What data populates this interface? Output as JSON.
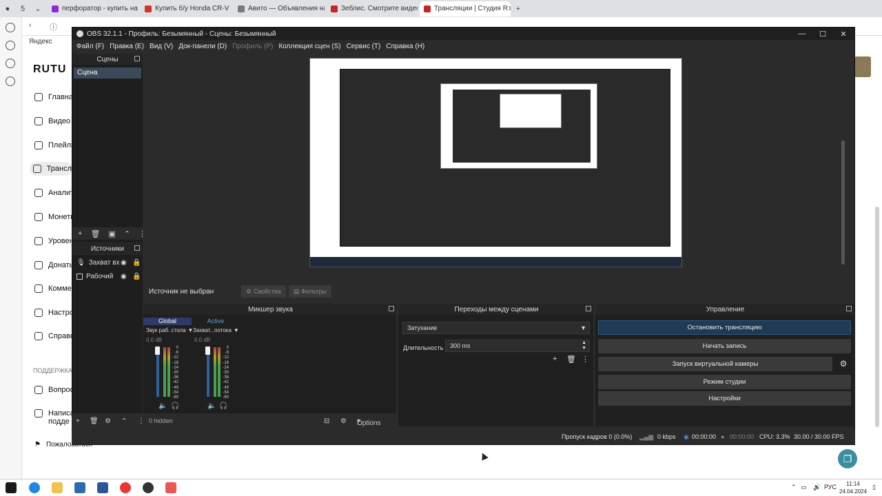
{
  "browser": {
    "tabs": [
      {
        "label": "перфоратор - купить на (",
        "color": "#8a2be2"
      },
      {
        "label": "Купить б/у Honda CR-V II",
        "color": "#d93025"
      },
      {
        "label": "Авито — Объявления на",
        "color": "#7a7a7a"
      },
      {
        "label": "Зеблис. Смотрите видео",
        "color": "#cc2222"
      },
      {
        "label": "Трансляции | Студия R",
        "color": "#cc2222"
      }
    ],
    "tab_count": "5",
    "bookmark": "Яндекс"
  },
  "page": {
    "logo": "RUTU",
    "nav": [
      "Главная",
      "Видео",
      "Плейли",
      "Трансл",
      "Аналит",
      "Монети",
      "Уровен",
      "Донаты",
      "Коммен",
      "Настро",
      "Справо"
    ],
    "support_heading": "ПОДДЕРЖКА",
    "support": [
      "Вопросы",
      "Написа",
      "подде"
    ],
    "complain": "Пожаловаться"
  },
  "obs": {
    "title": "OBS 32.1.1 - Профиль: Безымянный - Сцены: Безымянный",
    "menu": [
      "Файл (F)",
      "Правка (E)",
      "Вид (V)",
      "Док-панели (D)",
      "Профиль (P)",
      "Коллекция сцен (S)",
      "Сервис (T)",
      "Справка (H)"
    ],
    "scenes": {
      "heading": "Сцены",
      "items": [
        "Сцена"
      ]
    },
    "sources": {
      "heading": "Источники",
      "items": [
        "Захват вх",
        "Рабочий"
      ]
    },
    "context": {
      "no_source": "Источник не выбран",
      "properties": "Свойства",
      "filters": "Фильтры"
    },
    "mixer": {
      "heading": "Микшер звука",
      "tabs": [
        "Global",
        "Active"
      ],
      "channels": [
        {
          "name": "Звук раб. стола",
          "db": "0.0 dB"
        },
        {
          "name": "Захват...потока",
          "db": "0.0 dB"
        }
      ],
      "scale": [
        "0",
        "-6",
        "-12",
        "-18",
        "-24",
        "-30",
        "-36",
        "-42",
        "-48",
        "-54",
        "-60"
      ],
      "hidden": "0 hidden",
      "options": "Options"
    },
    "transitions": {
      "heading": "Переходы между сценами",
      "selected": "Затухание",
      "duration_label": "Длительность",
      "duration": "300 ms"
    },
    "controls": {
      "heading": "Управление",
      "buttons": [
        "Остановить трансляцию",
        "Начать запись",
        "Запуск виртуальной камеры",
        "Режим студии",
        "Настройки"
      ]
    },
    "status": {
      "dropped": "Пропуск кадров 0 (0.0%)",
      "kbps": "0 kbps",
      "stream_time": "00:00:00",
      "rec_time": "00:00:00",
      "cpu": "CPU: 3.3%",
      "fps": "30.00 / 30.00 FPS"
    }
  },
  "taskbar": {
    "lang": "РУС",
    "time": "11:14",
    "date": "24.04.2024"
  }
}
